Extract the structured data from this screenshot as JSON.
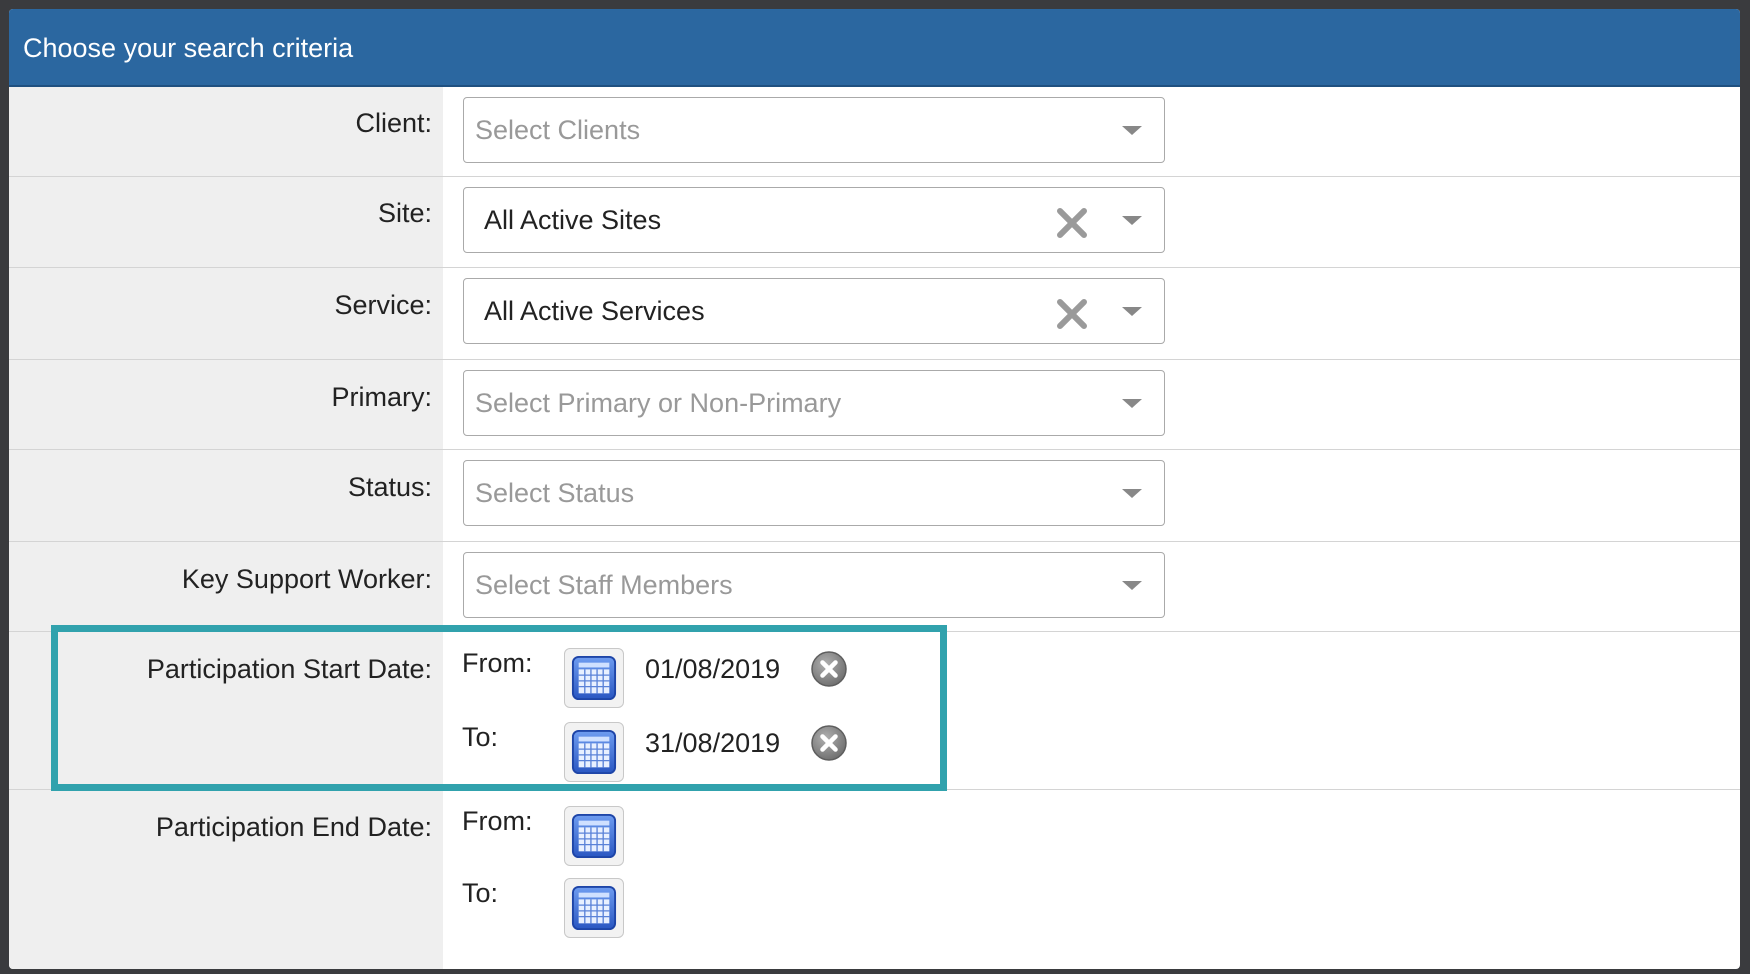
{
  "panel": {
    "title": "Choose your search criteria"
  },
  "fields": {
    "client": {
      "label": "Client:",
      "placeholder": "Select Clients"
    },
    "site": {
      "label": "Site:",
      "value": "All Active Sites"
    },
    "service": {
      "label": "Service:",
      "value": "All Active Services"
    },
    "primary": {
      "label": "Primary:",
      "placeholder": "Select Primary or Non-Primary"
    },
    "status": {
      "label": "Status:",
      "placeholder": "Select Status"
    },
    "key_support_worker": {
      "label": "Key Support Worker:",
      "placeholder": "Select Staff Members"
    }
  },
  "participation_start": {
    "label": "Participation Start Date:",
    "from_label": "From:",
    "from_value": "01/08/2019",
    "to_label": "To:",
    "to_value": "31/08/2019"
  },
  "participation_end": {
    "label": "Participation End Date:",
    "from_label": "From:",
    "from_value": "",
    "to_label": "To:",
    "to_value": ""
  },
  "icons": {
    "calendar": "calendar-icon",
    "clear": "clear-x-icon",
    "dropdown": "chevron-down-icon",
    "date_clear": "clear-circle-icon"
  },
  "colors": {
    "header": "#2b67a0",
    "highlight": "#31a2ad",
    "calendar": "#2f63c9"
  }
}
